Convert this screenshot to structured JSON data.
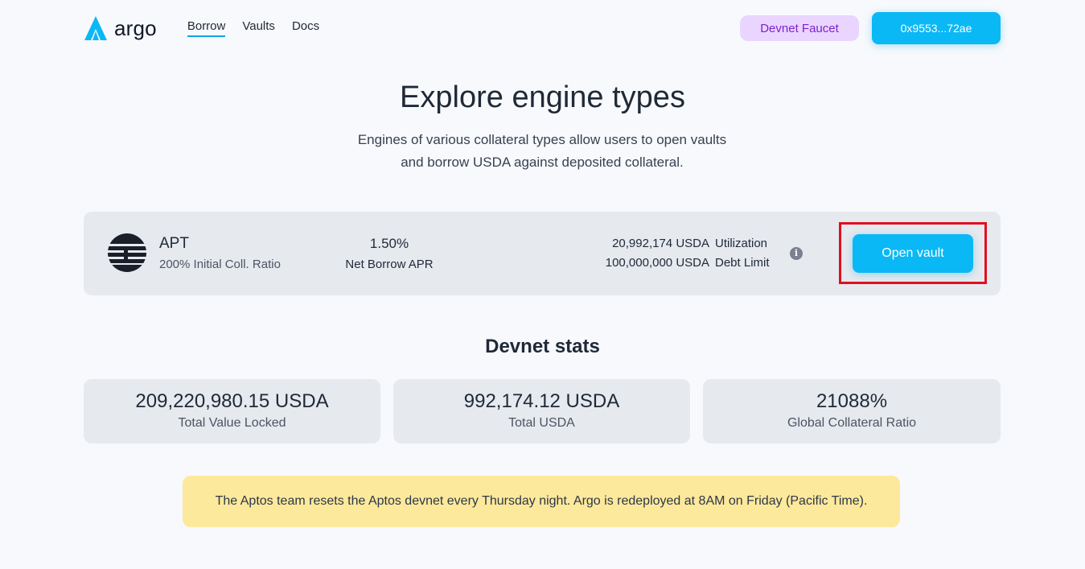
{
  "header": {
    "logo_text": "argo",
    "nav": [
      {
        "label": "Borrow",
        "active": true
      },
      {
        "label": "Vaults",
        "active": false
      },
      {
        "label": "Docs",
        "active": false
      }
    ],
    "faucet_label": "Devnet Faucet",
    "wallet_label": "0x9553...72ae"
  },
  "hero": {
    "title": "Explore engine types",
    "subtitle_line1": "Engines of various collateral types allow users to open vaults",
    "subtitle_line2": "and borrow USDA against deposited collateral."
  },
  "engine": {
    "name": "APT",
    "ratio_text": "200% Initial Coll. Ratio",
    "apr_value": "1.50%",
    "apr_label": "Net Borrow APR",
    "utilization_value": "20,992,174 USDA",
    "utilization_label": "Utilization",
    "debt_limit_value": "100,000,000 USDA",
    "debt_limit_label": "Debt Limit",
    "info_icon": "info-icon",
    "open_vault_label": "Open vault"
  },
  "stats": {
    "title": "Devnet stats",
    "items": [
      {
        "value": "209,220,980.15 USDA",
        "label": "Total Value Locked"
      },
      {
        "value": "992,174.12 USDA",
        "label": "Total USDA"
      },
      {
        "value": "21088%",
        "label": "Global Collateral Ratio"
      }
    ]
  },
  "notice": {
    "text": "The Aptos team resets the Aptos devnet every Thursday night. Argo is redeployed at 8AM on Friday (Pacific Time)."
  },
  "colors": {
    "accent": "#0ab8f5",
    "faucet_bg": "#e9d5ff",
    "faucet_text": "#7e22ce",
    "card_bg": "#e6e9ee",
    "notice_bg": "#fde99b",
    "highlight_border": "#e0101f"
  }
}
